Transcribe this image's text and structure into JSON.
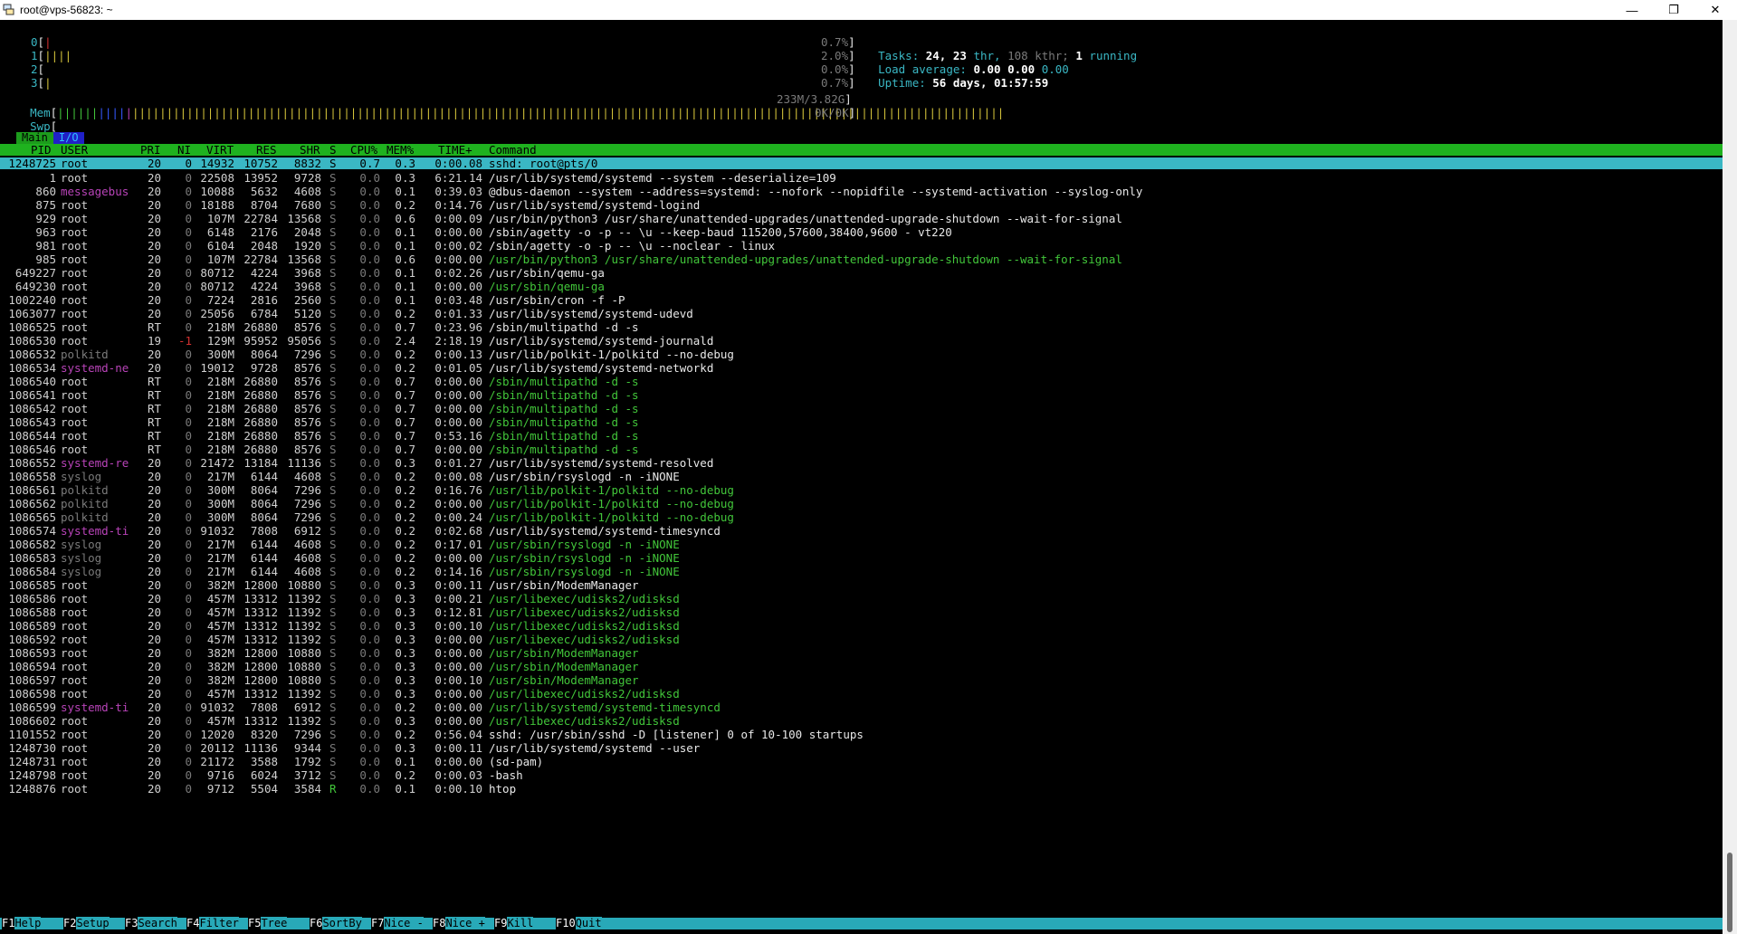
{
  "window": {
    "title": "root@vps-56823: ~"
  },
  "cpu_meters": [
    {
      "label": "0",
      "bars": [
        {
          "color": "#d33030",
          "text": "|"
        }
      ],
      "value": "0.7%"
    },
    {
      "label": "1",
      "bars": [
        {
          "color": "#d3c23a",
          "text": "||||"
        }
      ],
      "value": "2.0%"
    },
    {
      "label": "2",
      "bars": [],
      "value": "0.0%"
    },
    {
      "label": "3",
      "bars": [
        {
          "color": "#d3c23a",
          "text": "|"
        }
      ],
      "value": "0.7%"
    }
  ],
  "mem_meter": {
    "label": "Mem",
    "value": "233M/3.82G"
  },
  "swp_meter": {
    "label": "Swp",
    "value": "0K/0K"
  },
  "summary": {
    "tasks_label": "Tasks:",
    "tasks": "24,",
    "thr": "23",
    "thr_label": "thr,",
    "kthr": "108 kthr;",
    "running": "1",
    "running_label": "running",
    "load_label": "Load average:",
    "load1": "0.00",
    "load5": "0.00",
    "load15": "0.00",
    "uptime_label": "Uptime:",
    "uptime": "56 days, 01:57:59"
  },
  "tabs": [
    "Main",
    "I/O"
  ],
  "columns": [
    "PID",
    "USER",
    "PRI",
    "NI",
    "VIRT",
    "RES",
    "SHR",
    "S",
    "CPU%",
    "MEM%",
    "TIME+",
    "Command"
  ],
  "processes": [
    {
      "pid": "1248725",
      "user": "root",
      "pri": "20",
      "ni": "0",
      "virt": "14932",
      "res": "10752",
      "shr": "8832",
      "s": "S",
      "cpu": "0.7",
      "mem": "0.3",
      "time": "0:00.08",
      "cmd": "sshd: root@pts/0"
    },
    {
      "pid": "1",
      "user": "root",
      "pri": "20",
      "ni": "0",
      "virt": "22508",
      "res": "13952",
      "shr": "9728",
      "s": "S",
      "cpu": "0.0",
      "mem": "0.3",
      "time": "6:21.14",
      "cmd": "/usr/lib/systemd/systemd --system --deserialize=109"
    },
    {
      "pid": "860",
      "user": "messagebus",
      "pri": "20",
      "ni": "0",
      "virt": "10088",
      "res": "5632",
      "shr": "4608",
      "s": "S",
      "cpu": "0.0",
      "mem": "0.1",
      "time": "0:39.03",
      "cmd": "@dbus-daemon --system --address=systemd: --nofork --nopidfile --systemd-activation --syslog-only"
    },
    {
      "pid": "875",
      "user": "root",
      "pri": "20",
      "ni": "0",
      "virt": "18188",
      "res": "8704",
      "shr": "7680",
      "s": "S",
      "cpu": "0.0",
      "mem": "0.2",
      "time": "0:14.76",
      "cmd": "/usr/lib/systemd/systemd-logind"
    },
    {
      "pid": "929",
      "user": "root",
      "pri": "20",
      "ni": "0",
      "virt": "107M",
      "res": "22784",
      "shr": "13568",
      "s": "S",
      "cpu": "0.0",
      "mem": "0.6",
      "time": "0:00.09",
      "cmd": "/usr/bin/python3 /usr/share/unattended-upgrades/unattended-upgrade-shutdown --wait-for-signal"
    },
    {
      "pid": "963",
      "user": "root",
      "pri": "20",
      "ni": "0",
      "virt": "6148",
      "res": "2176",
      "shr": "2048",
      "s": "S",
      "cpu": "0.0",
      "mem": "0.1",
      "time": "0:00.00",
      "cmd": "/sbin/agetty -o -p -- \\u --keep-baud 115200,57600,38400,9600 - vt220"
    },
    {
      "pid": "981",
      "user": "root",
      "pri": "20",
      "ni": "0",
      "virt": "6104",
      "res": "2048",
      "shr": "1920",
      "s": "S",
      "cpu": "0.0",
      "mem": "0.1",
      "time": "0:00.02",
      "cmd": "/sbin/agetty -o -p -- \\u --noclear - linux"
    },
    {
      "pid": "985",
      "user": "root",
      "pri": "20",
      "ni": "0",
      "virt": "107M",
      "res": "22784",
      "shr": "13568",
      "s": "S",
      "cpu": "0.0",
      "mem": "0.6",
      "time": "0:00.00",
      "cmd": "/usr/bin/python3 /usr/share/unattended-upgrades/unattended-upgrade-shutdown --wait-for-signal"
    },
    {
      "pid": "649227",
      "user": "root",
      "pri": "20",
      "ni": "0",
      "virt": "80712",
      "res": "4224",
      "shr": "3968",
      "s": "S",
      "cpu": "0.0",
      "mem": "0.1",
      "time": "0:02.26",
      "cmd": "/usr/sbin/qemu-ga"
    },
    {
      "pid": "649230",
      "user": "root",
      "pri": "20",
      "ni": "0",
      "virt": "80712",
      "res": "4224",
      "shr": "3968",
      "s": "S",
      "cpu": "0.0",
      "mem": "0.1",
      "time": "0:00.00",
      "cmd": "/usr/sbin/qemu-ga"
    },
    {
      "pid": "1002240",
      "user": "root",
      "pri": "20",
      "ni": "0",
      "virt": "7224",
      "res": "2816",
      "shr": "2560",
      "s": "S",
      "cpu": "0.0",
      "mem": "0.1",
      "time": "0:03.48",
      "cmd": "/usr/sbin/cron -f -P"
    },
    {
      "pid": "1063077",
      "user": "root",
      "pri": "20",
      "ni": "0",
      "virt": "25056",
      "res": "6784",
      "shr": "5120",
      "s": "S",
      "cpu": "0.0",
      "mem": "0.2",
      "time": "0:01.33",
      "cmd": "/usr/lib/systemd/systemd-udevd"
    },
    {
      "pid": "1086525",
      "user": "root",
      "pri": "RT",
      "ni": "0",
      "virt": "218M",
      "res": "26880",
      "shr": "8576",
      "s": "S",
      "cpu": "0.0",
      "mem": "0.7",
      "time": "0:23.96",
      "cmd": "/sbin/multipathd -d -s"
    },
    {
      "pid": "1086530",
      "user": "root",
      "pri": "19",
      "ni": "-1",
      "virt": "129M",
      "res": "95952",
      "shr": "95056",
      "s": "S",
      "cpu": "0.0",
      "mem": "2.4",
      "time": "2:18.19",
      "cmd": "/usr/lib/systemd/systemd-journald"
    },
    {
      "pid": "1086532",
      "user": "polkitd",
      "pri": "20",
      "ni": "0",
      "virt": "300M",
      "res": "8064",
      "shr": "7296",
      "s": "S",
      "cpu": "0.0",
      "mem": "0.2",
      "time": "0:00.13",
      "cmd": "/usr/lib/polkit-1/polkitd --no-debug"
    },
    {
      "pid": "1086534",
      "user": "systemd-ne",
      "pri": "20",
      "ni": "0",
      "virt": "19012",
      "res": "9728",
      "shr": "8576",
      "s": "S",
      "cpu": "0.0",
      "mem": "0.2",
      "time": "0:01.05",
      "cmd": "/usr/lib/systemd/systemd-networkd"
    },
    {
      "pid": "1086540",
      "user": "root",
      "pri": "RT",
      "ni": "0",
      "virt": "218M",
      "res": "26880",
      "shr": "8576",
      "s": "S",
      "cpu": "0.0",
      "mem": "0.7",
      "time": "0:00.00",
      "cmd": "/sbin/multipathd -d -s"
    },
    {
      "pid": "1086541",
      "user": "root",
      "pri": "RT",
      "ni": "0",
      "virt": "218M",
      "res": "26880",
      "shr": "8576",
      "s": "S",
      "cpu": "0.0",
      "mem": "0.7",
      "time": "0:00.00",
      "cmd": "/sbin/multipathd -d -s"
    },
    {
      "pid": "1086542",
      "user": "root",
      "pri": "RT",
      "ni": "0",
      "virt": "218M",
      "res": "26880",
      "shr": "8576",
      "s": "S",
      "cpu": "0.0",
      "mem": "0.7",
      "time": "0:00.00",
      "cmd": "/sbin/multipathd -d -s"
    },
    {
      "pid": "1086543",
      "user": "root",
      "pri": "RT",
      "ni": "0",
      "virt": "218M",
      "res": "26880",
      "shr": "8576",
      "s": "S",
      "cpu": "0.0",
      "mem": "0.7",
      "time": "0:00.00",
      "cmd": "/sbin/multipathd -d -s"
    },
    {
      "pid": "1086544",
      "user": "root",
      "pri": "RT",
      "ni": "0",
      "virt": "218M",
      "res": "26880",
      "shr": "8576",
      "s": "S",
      "cpu": "0.0",
      "mem": "0.7",
      "time": "0:53.16",
      "cmd": "/sbin/multipathd -d -s"
    },
    {
      "pid": "1086546",
      "user": "root",
      "pri": "RT",
      "ni": "0",
      "virt": "218M",
      "res": "26880",
      "shr": "8576",
      "s": "S",
      "cpu": "0.0",
      "mem": "0.7",
      "time": "0:00.00",
      "cmd": "/sbin/multipathd -d -s"
    },
    {
      "pid": "1086552",
      "user": "systemd-re",
      "pri": "20",
      "ni": "0",
      "virt": "21472",
      "res": "13184",
      "shr": "11136",
      "s": "S",
      "cpu": "0.0",
      "mem": "0.3",
      "time": "0:01.27",
      "cmd": "/usr/lib/systemd/systemd-resolved"
    },
    {
      "pid": "1086558",
      "user": "syslog",
      "pri": "20",
      "ni": "0",
      "virt": "217M",
      "res": "6144",
      "shr": "4608",
      "s": "S",
      "cpu": "0.0",
      "mem": "0.2",
      "time": "0:00.08",
      "cmd": "/usr/sbin/rsyslogd -n -iNONE"
    },
    {
      "pid": "1086561",
      "user": "polkitd",
      "pri": "20",
      "ni": "0",
      "virt": "300M",
      "res": "8064",
      "shr": "7296",
      "s": "S",
      "cpu": "0.0",
      "mem": "0.2",
      "time": "0:16.76",
      "cmd": "/usr/lib/polkit-1/polkitd --no-debug"
    },
    {
      "pid": "1086562",
      "user": "polkitd",
      "pri": "20",
      "ni": "0",
      "virt": "300M",
      "res": "8064",
      "shr": "7296",
      "s": "S",
      "cpu": "0.0",
      "mem": "0.2",
      "time": "0:00.00",
      "cmd": "/usr/lib/polkit-1/polkitd --no-debug"
    },
    {
      "pid": "1086565",
      "user": "polkitd",
      "pri": "20",
      "ni": "0",
      "virt": "300M",
      "res": "8064",
      "shr": "7296",
      "s": "S",
      "cpu": "0.0",
      "mem": "0.2",
      "time": "0:00.24",
      "cmd": "/usr/lib/polkit-1/polkitd --no-debug"
    },
    {
      "pid": "1086574",
      "user": "systemd-ti",
      "pri": "20",
      "ni": "0",
      "virt": "91032",
      "res": "7808",
      "shr": "6912",
      "s": "S",
      "cpu": "0.0",
      "mem": "0.2",
      "time": "0:02.68",
      "cmd": "/usr/lib/systemd/systemd-timesyncd"
    },
    {
      "pid": "1086582",
      "user": "syslog",
      "pri": "20",
      "ni": "0",
      "virt": "217M",
      "res": "6144",
      "shr": "4608",
      "s": "S",
      "cpu": "0.0",
      "mem": "0.2",
      "time": "0:17.01",
      "cmd": "/usr/sbin/rsyslogd -n -iNONE"
    },
    {
      "pid": "1086583",
      "user": "syslog",
      "pri": "20",
      "ni": "0",
      "virt": "217M",
      "res": "6144",
      "shr": "4608",
      "s": "S",
      "cpu": "0.0",
      "mem": "0.2",
      "time": "0:00.00",
      "cmd": "/usr/sbin/rsyslogd -n -iNONE"
    },
    {
      "pid": "1086584",
      "user": "syslog",
      "pri": "20",
      "ni": "0",
      "virt": "217M",
      "res": "6144",
      "shr": "4608",
      "s": "S",
      "cpu": "0.0",
      "mem": "0.2",
      "time": "0:14.16",
      "cmd": "/usr/sbin/rsyslogd -n -iNONE"
    },
    {
      "pid": "1086585",
      "user": "root",
      "pri": "20",
      "ni": "0",
      "virt": "382M",
      "res": "12800",
      "shr": "10880",
      "s": "S",
      "cpu": "0.0",
      "mem": "0.3",
      "time": "0:00.11",
      "cmd": "/usr/sbin/ModemManager"
    },
    {
      "pid": "1086586",
      "user": "root",
      "pri": "20",
      "ni": "0",
      "virt": "457M",
      "res": "13312",
      "shr": "11392",
      "s": "S",
      "cpu": "0.0",
      "mem": "0.3",
      "time": "0:00.21",
      "cmd": "/usr/libexec/udisks2/udisksd"
    },
    {
      "pid": "1086588",
      "user": "root",
      "pri": "20",
      "ni": "0",
      "virt": "457M",
      "res": "13312",
      "shr": "11392",
      "s": "S",
      "cpu": "0.0",
      "mem": "0.3",
      "time": "0:12.81",
      "cmd": "/usr/libexec/udisks2/udisksd"
    },
    {
      "pid": "1086589",
      "user": "root",
      "pri": "20",
      "ni": "0",
      "virt": "457M",
      "res": "13312",
      "shr": "11392",
      "s": "S",
      "cpu": "0.0",
      "mem": "0.3",
      "time": "0:00.10",
      "cmd": "/usr/libexec/udisks2/udisksd"
    },
    {
      "pid": "1086592",
      "user": "root",
      "pri": "20",
      "ni": "0",
      "virt": "457M",
      "res": "13312",
      "shr": "11392",
      "s": "S",
      "cpu": "0.0",
      "mem": "0.3",
      "time": "0:00.00",
      "cmd": "/usr/libexec/udisks2/udisksd"
    },
    {
      "pid": "1086593",
      "user": "root",
      "pri": "20",
      "ni": "0",
      "virt": "382M",
      "res": "12800",
      "shr": "10880",
      "s": "S",
      "cpu": "0.0",
      "mem": "0.3",
      "time": "0:00.00",
      "cmd": "/usr/sbin/ModemManager"
    },
    {
      "pid": "1086594",
      "user": "root",
      "pri": "20",
      "ni": "0",
      "virt": "382M",
      "res": "12800",
      "shr": "10880",
      "s": "S",
      "cpu": "0.0",
      "mem": "0.3",
      "time": "0:00.00",
      "cmd": "/usr/sbin/ModemManager"
    },
    {
      "pid": "1086597",
      "user": "root",
      "pri": "20",
      "ni": "0",
      "virt": "382M",
      "res": "12800",
      "shr": "10880",
      "s": "S",
      "cpu": "0.0",
      "mem": "0.3",
      "time": "0:00.10",
      "cmd": "/usr/sbin/ModemManager"
    },
    {
      "pid": "1086598",
      "user": "root",
      "pri": "20",
      "ni": "0",
      "virt": "457M",
      "res": "13312",
      "shr": "11392",
      "s": "S",
      "cpu": "0.0",
      "mem": "0.3",
      "time": "0:00.00",
      "cmd": "/usr/libexec/udisks2/udisksd"
    },
    {
      "pid": "1086599",
      "user": "systemd-ti",
      "pri": "20",
      "ni": "0",
      "virt": "91032",
      "res": "7808",
      "shr": "6912",
      "s": "S",
      "cpu": "0.0",
      "mem": "0.2",
      "time": "0:00.00",
      "cmd": "/usr/lib/systemd/systemd-timesyncd"
    },
    {
      "pid": "1086602",
      "user": "root",
      "pri": "20",
      "ni": "0",
      "virt": "457M",
      "res": "13312",
      "shr": "11392",
      "s": "S",
      "cpu": "0.0",
      "mem": "0.3",
      "time": "0:00.00",
      "cmd": "/usr/libexec/udisks2/udisksd"
    },
    {
      "pid": "1101552",
      "user": "root",
      "pri": "20",
      "ni": "0",
      "virt": "12020",
      "res": "8320",
      "shr": "7296",
      "s": "S",
      "cpu": "0.0",
      "mem": "0.2",
      "time": "0:56.04",
      "cmd": "sshd: /usr/sbin/sshd -D [listener] 0 of 10-100 startups"
    },
    {
      "pid": "1248730",
      "user": "root",
      "pri": "20",
      "ni": "0",
      "virt": "20112",
      "res": "11136",
      "shr": "9344",
      "s": "S",
      "cpu": "0.0",
      "mem": "0.3",
      "time": "0:00.11",
      "cmd": "/usr/lib/systemd/systemd --user"
    },
    {
      "pid": "1248731",
      "user": "root",
      "pri": "20",
      "ni": "0",
      "virt": "21172",
      "res": "3588",
      "shr": "1792",
      "s": "S",
      "cpu": "0.0",
      "mem": "0.1",
      "time": "0:00.00",
      "cmd": "(sd-pam)"
    },
    {
      "pid": "1248798",
      "user": "root",
      "pri": "20",
      "ni": "0",
      "virt": "9716",
      "res": "6024",
      "shr": "3712",
      "s": "S",
      "cpu": "0.0",
      "mem": "0.2",
      "time": "0:00.03",
      "cmd": "-bash"
    },
    {
      "pid": "1248876",
      "user": "root",
      "pri": "20",
      "ni": "0",
      "virt": "9712",
      "res": "5504",
      "shr": "3584",
      "s": "R",
      "cpu": "0.0",
      "mem": "0.1",
      "time": "0:00.10",
      "cmd": "htop"
    }
  ],
  "footer": [
    {
      "key": "F1",
      "label": "Help  "
    },
    {
      "key": "F2",
      "label": "Setup "
    },
    {
      "key": "F3",
      "label": "Search"
    },
    {
      "key": "F4",
      "label": "Filter"
    },
    {
      "key": "F5",
      "label": "Tree  "
    },
    {
      "key": "F6",
      "label": "SortBy"
    },
    {
      "key": "F7",
      "label": "Nice -"
    },
    {
      "key": "F8",
      "label": "Nice +"
    },
    {
      "key": "F9",
      "label": "Kill  "
    },
    {
      "key": "F10",
      "label": "Quit  "
    }
  ]
}
